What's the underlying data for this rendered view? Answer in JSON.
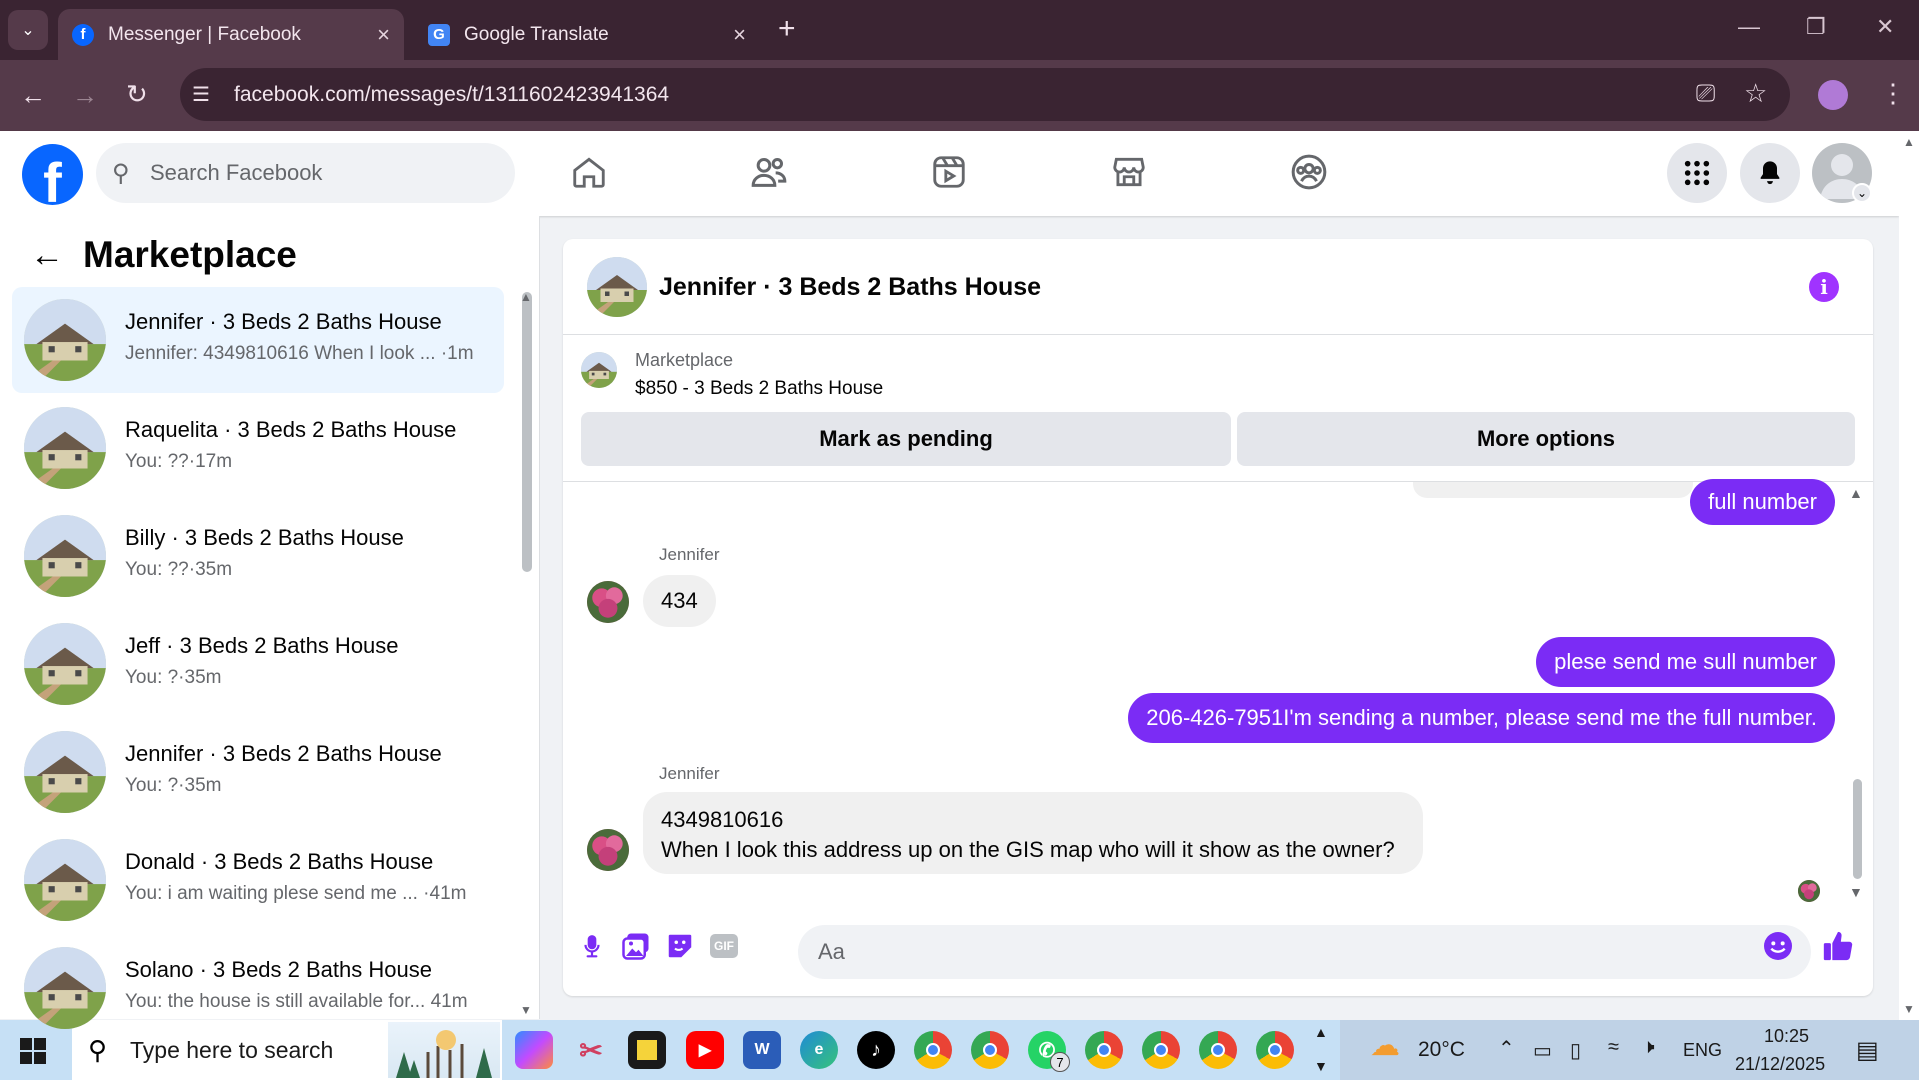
{
  "browser": {
    "tabs": [
      {
        "title": "Messenger | Facebook",
        "favicon": "facebook-icon"
      },
      {
        "title": "Google Translate",
        "favicon": "google-translate-icon"
      }
    ],
    "new_tab": "+",
    "url": "facebook.com/messages/t/1311602423941364"
  },
  "fb": {
    "search_placeholder": "Search Facebook",
    "accent": "#0866ff",
    "nav": [
      "home-icon",
      "friends-icon",
      "video-icon",
      "marketplace-icon",
      "groups-icon"
    ]
  },
  "left": {
    "title": "Marketplace",
    "conversations": [
      {
        "name": "Jennifer · 3 Beds 2 Baths House",
        "preview": "Jennifer: 4349810616 When I look ... ·1m"
      },
      {
        "name": "Raquelita · 3 Beds 2 Baths House",
        "preview": "You: ??·17m"
      },
      {
        "name": "Billy · 3 Beds 2 Baths House",
        "preview": "You: ??·35m"
      },
      {
        "name": "Jeff · 3 Beds 2 Baths House",
        "preview": "You: ?·35m"
      },
      {
        "name": "Jennifer · 3 Beds 2 Baths House",
        "preview": "You: ?·35m"
      },
      {
        "name": "Donald · 3 Beds 2 Baths House",
        "preview": "You: i am waiting plese send me ... ·41m"
      },
      {
        "name": "Solano · 3 Beds 2 Baths House",
        "preview": "You: the house is still available for... 41m"
      }
    ]
  },
  "chat": {
    "title": "Jennifer · 3 Beds 2 Baths House",
    "listing_source": "Marketplace",
    "listing_price": "$850 - 3 Beds 2 Baths House",
    "mark_pending": "Mark as pending",
    "more_options": "More options",
    "messages": [
      {
        "from": "me",
        "text": "full number"
      },
      {
        "from": "Jennifer",
        "sender": "Jennifer",
        "text": "434"
      },
      {
        "from": "me",
        "text": "plese send me sull number"
      },
      {
        "from": "me",
        "text": "206-426-7951I'm sending a number, please send me the full number."
      },
      {
        "from": "Jennifer",
        "sender": "Jennifer",
        "line1": "4349810616",
        "line2": "When I look this address up on the GIS map who will it show as the owner?"
      }
    ],
    "composer_placeholder": "Aa",
    "gif_label": "GIF",
    "outgoing_color": "#7b2cf5"
  },
  "taskbar": {
    "search_placeholder": "Type here to search",
    "weather": "20°C",
    "language": "ENG",
    "time": "10:25",
    "date": "21/12/2025",
    "whatsapp_badge": "7"
  }
}
